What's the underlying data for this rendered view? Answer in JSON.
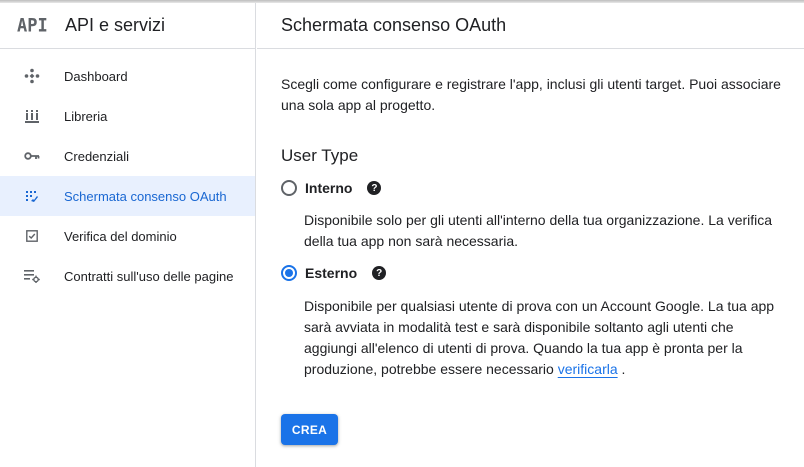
{
  "sidebar": {
    "logo": "API",
    "title": "API e servizi",
    "items": [
      {
        "label": "Dashboard",
        "icon": "dashboard-icon",
        "active": false
      },
      {
        "label": "Libreria",
        "icon": "library-icon",
        "active": false
      },
      {
        "label": "Credenziali",
        "icon": "key-icon",
        "active": false
      },
      {
        "label": "Schermata consenso OAuth",
        "icon": "consent-screen-icon",
        "active": true
      },
      {
        "label": "Verifica del dominio",
        "icon": "domain-verification-icon",
        "active": false
      },
      {
        "label": "Contratti sull'uso delle pagine",
        "icon": "page-usage-agreements-icon",
        "active": false
      }
    ]
  },
  "main": {
    "title": "Schermata consenso OAuth",
    "intro": "Scegli come configurare e registrare l'app, inclusi gli utenti target. Puoi associare una sola app al progetto.",
    "user_type": {
      "title": "User Type",
      "options": [
        {
          "label": "Interno",
          "checked": false,
          "description": "Disponibile solo per gli utenti all'interno della tua organizzazione. La verifica della tua app non sarà necessaria."
        },
        {
          "label": "Esterno",
          "checked": true,
          "description_before_link": "Disponibile per qualsiasi utente di prova con un Account Google. La tua app sarà avviata in modalità test e sarà disponibile soltanto agli utenti che aggiungi all'elenco di utenti di prova. Quando la tua app è pronta per la produzione, potrebbe essere necessario ",
          "link": "verificarla",
          "description_after_link": " ."
        }
      ]
    },
    "create_button": "CREA"
  },
  "colors": {
    "accent": "#1a73e8",
    "active_bg": "#e8f0fe",
    "border": "#dadce0"
  }
}
